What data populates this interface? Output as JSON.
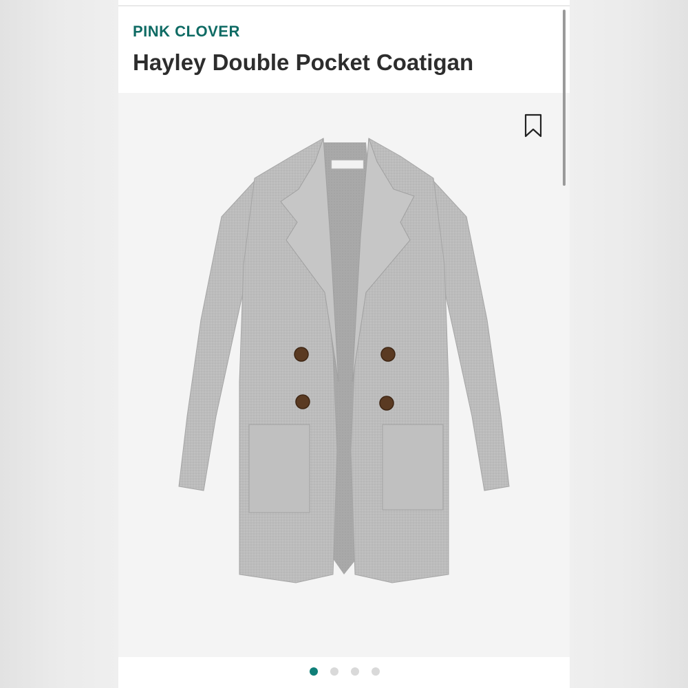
{
  "product": {
    "brand": "PINK CLOVER",
    "title": "Hayley Double Pocket Coatigan",
    "image_subject": "gray-coatigan-photo",
    "label_tag_text": "PINK CLOVER"
  },
  "carousel": {
    "total_images": 4,
    "active_index": 0
  },
  "colors": {
    "brand": "#0f6b64",
    "title": "#2d2d2d",
    "active_dot": "#0f7f78",
    "inactive_dot": "#d9d9d9",
    "garment": "#bdbdbd",
    "buttons": "#5a3a22"
  },
  "icons": {
    "save": "bookmark-icon"
  }
}
